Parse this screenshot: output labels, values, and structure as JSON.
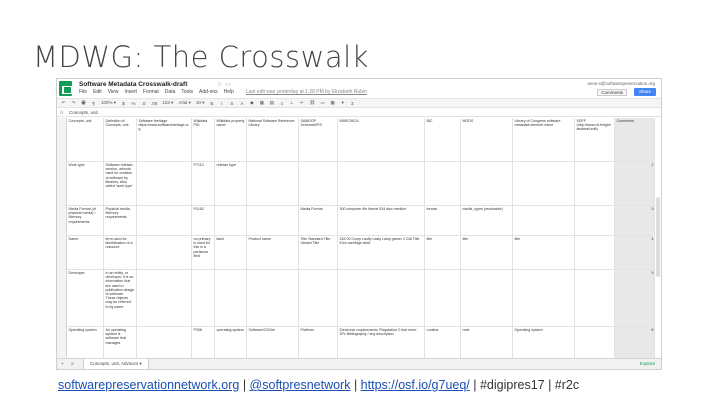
{
  "slide": {
    "title": "MDWG: The Crosswalk"
  },
  "window": {
    "doc_title": "Software Metadata Crosswalk-draft",
    "user_email": "anne.s@softwarepreservation.org",
    "comments_label": "Comments",
    "share_label": "Share",
    "menu": [
      "File",
      "Edit",
      "View",
      "Insert",
      "Format",
      "Data",
      "Tools",
      "Add-ons",
      "Help"
    ],
    "last_edit": "Last edit was yesterday at 1:28 PM by Elizabeth Rubin"
  },
  "toolbar": {
    "items": [
      "↶",
      "↷",
      "🖶",
      "¶",
      "100% ▾",
      "$",
      "%",
      ".0",
      ".00",
      "123 ▾",
      "Arial ▾",
      "10 ▾",
      "B",
      "I",
      "S",
      "A",
      "◆",
      "▦",
      "▤",
      "≡",
      "⊥",
      "↵",
      "⛓",
      "▭",
      "▦",
      "▾",
      "Σ"
    ]
  },
  "formula": {
    "fx": "fx",
    "content": "Concepts, unit"
  },
  "grid": {
    "header": [
      "Concepts, unit",
      "Definition of Concepts, unit",
      "Software Heritage https://www.softwareheritage.org",
      "Wikidata PID",
      "Wikidata property name",
      "National Software Reference Library",
      "SAMDOP SchemaVIPS",
      "MARC/BCA",
      "IBC",
      "MODS",
      "Library of Congress software metadata element name",
      "VDFF (http://www.cd.freighhalsdetail.edit)",
      "Comments"
    ],
    "rows": [
      {
        "cells": [
          "Work type",
          "Software release, version, artwork used for creation of software by libraries, Also called 'work type'",
          "",
          "P7110",
          "release type",
          "",
          "",
          "",
          "",
          "",
          "",
          "",
          ""
        ],
        "num": "2"
      },
      {
        "cells": [
          "Media Format (of physical media) / Memory requirements",
          "Physical media. Memory requirements.",
          "",
          "P1163",
          "",
          "",
          "Media Format",
          "300 computer file format 534 disc medium",
          "format",
          "media_types (resolvable)",
          "",
          "",
          ""
        ],
        "num": "3"
      },
      {
        "cells": [
          "Name",
          "term used for identification of a resource",
          "",
          "no primary is used for this in a particular field",
          "label",
          "Product name",
          "Title Standard Title Variant Title",
          "245 00 Comp Lastly Lasty Lasty gamer 2 246 Title Elon cartridge label",
          "title",
          "title",
          "title",
          "",
          ""
        ],
        "num": "4"
      },
      {
        "cells": [
          "Developer",
          "In an entity, or developer, it is an information that are used to publication design of software. These objects may be referred to by name",
          "",
          "",
          "",
          "",
          "",
          "",
          "",
          "",
          "",
          "",
          ""
        ],
        "num": "5"
      },
      {
        "cells": [
          "Operating system",
          "An operating system is software that manages",
          "",
          "P306",
          "operating system",
          "Software/OS/Ver",
          "Platform",
          "Electronic requirements: Playstation 2 that more: 3Pc Bibliography / any description",
          "runtime",
          "note",
          "Operating system",
          "",
          ""
        ],
        "num": "6"
      }
    ]
  },
  "sheet_tabs": {
    "add": "+",
    "list": "≡",
    "active": "Concepts, unit, Advisors ▾",
    "explore": "Explore"
  },
  "footer": {
    "link1": "softwarepreservationnetwork.org",
    "sep1": " | ",
    "link2": "@softpresnetwork",
    "sep2": " | ",
    "link3": "https://osf.io/g7ueq/",
    "rest": " | #digipres17 | #r2c"
  }
}
